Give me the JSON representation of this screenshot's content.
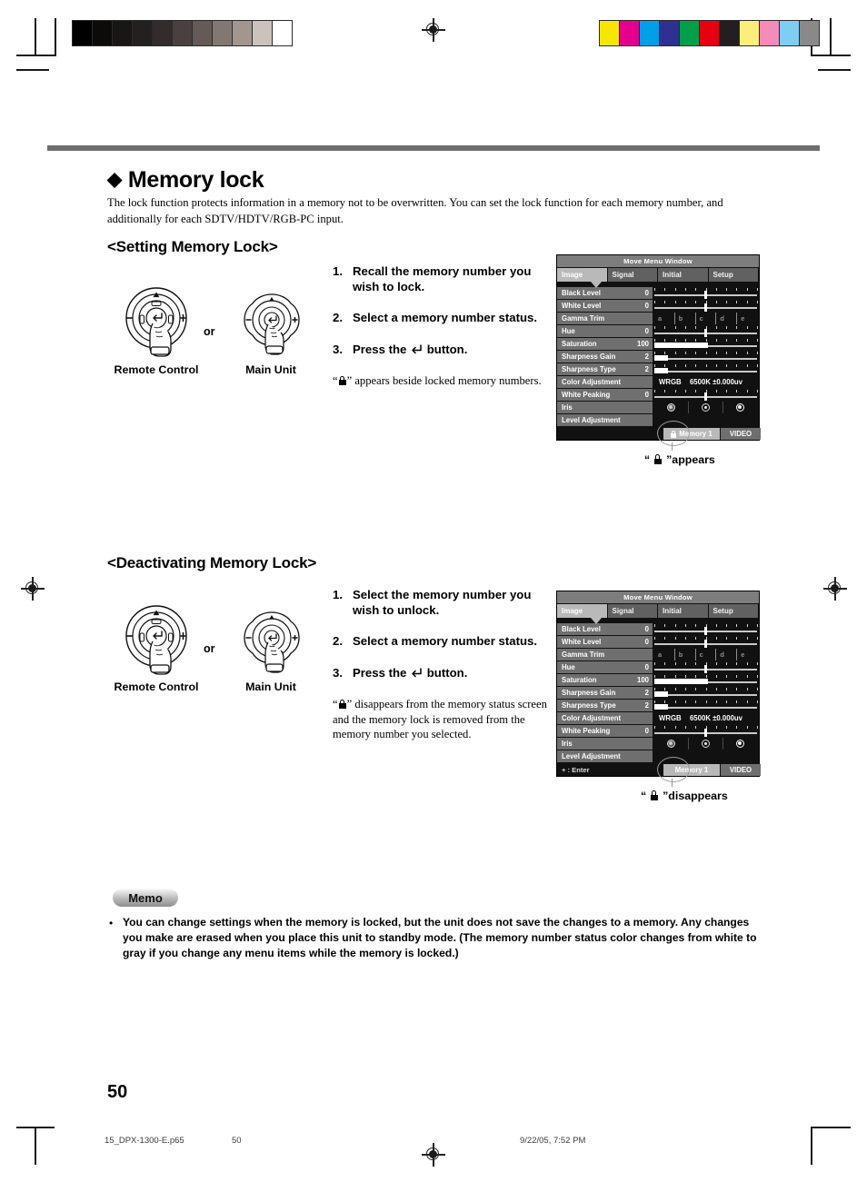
{
  "page": {
    "number": "50",
    "title": "Memory lock",
    "title_bullet": "◆",
    "intro": "The lock function protects information in a memory not to be overwritten. You can set the lock function for each memory number, and additionally for each SDTV/HDTV/RGB-PC input."
  },
  "sections": [
    {
      "heading": "<Setting Memory Lock>",
      "steps": [
        {
          "num": "1.",
          "text": "Recall the memory number you wish to lock."
        },
        {
          "num": "2.",
          "text": "Select a memory number status."
        },
        {
          "num": "3.",
          "text": "Press the  button."
        }
      ],
      "note_prefix": "“",
      "note_suffix": "” appears beside locked memory numbers.",
      "caption_prefix": "“",
      "caption_suffix": "”appears"
    },
    {
      "heading": "<Deactivating Memory Lock>",
      "steps": [
        {
          "num": "1.",
          "text": "Select the memory number you wish to unlock."
        },
        {
          "num": "2.",
          "text": "Select a memory number status."
        },
        {
          "num": "3.",
          "text": "Press the  button."
        }
      ],
      "note_prefix": "“",
      "note_suffix": "” disappears from the memory status screen and the memory lock is removed from the memory number you selected.",
      "caption_prefix": "“",
      "caption_suffix": "”disappears"
    }
  ],
  "controls": {
    "remote_label": "Remote Control",
    "main_label": "Main Unit",
    "or_label": "or",
    "up_glyph": "▲",
    "minus_glyph": "–",
    "plus_glyph": "+"
  },
  "osd": {
    "window_title": "Move Menu Window",
    "tabs": [
      {
        "label": "Image",
        "active": true
      },
      {
        "label": "Signal",
        "active": false
      },
      {
        "label": "Initial",
        "active": false
      },
      {
        "label": "Setup",
        "active": false
      }
    ],
    "rows": [
      {
        "label": "Black Level",
        "value": "0",
        "ctl": "slider",
        "pos": 50
      },
      {
        "label": "White Level",
        "value": "0",
        "ctl": "slider",
        "pos": 50
      },
      {
        "label": "Gamma Trim",
        "value": "",
        "ctl": "segments",
        "segments": [
          "a",
          "b",
          "c",
          "d",
          "e"
        ]
      },
      {
        "label": "Hue",
        "value": "0",
        "ctl": "slider",
        "pos": 50
      },
      {
        "label": "Saturation",
        "value": "100",
        "ctl": "fill",
        "pos": 52
      },
      {
        "label": "Sharpness Gain",
        "value": "2",
        "ctl": "fill",
        "pos": 13
      },
      {
        "label": "Sharpness Type",
        "value": "2",
        "ctl": "fill",
        "pos": 13
      },
      {
        "label": "Color Adjustment",
        "value": "",
        "ctl": "coloradj",
        "a": "WRGB",
        "b": "6500K ±0.000uv"
      },
      {
        "label": "White Peaking",
        "value": "0",
        "ctl": "slider",
        "pos": 50
      },
      {
        "label": "Iris",
        "value": "",
        "ctl": "iris"
      },
      {
        "label": "Level Adjustment",
        "value": "",
        "ctl": "none"
      }
    ],
    "memory_label": "Memory 1",
    "input_label": "VIDEO",
    "enter_hint": "+ : Enter"
  },
  "memo": {
    "title": "Memo",
    "bullet": "•",
    "text": "You can change settings when the memory is locked, but the unit does not save the changes to a memory. Any changes you make are erased when you place this unit to standby mode. (The memory number status color changes from white to gray if you change any menu items while the memory is locked.)"
  },
  "print_footer": {
    "filename": "15_DPX-1300-E.p65",
    "page": "50",
    "timestamp": "9/22/05, 7:52 PM"
  },
  "calibration": {
    "gray_steps": [
      "#000000",
      "#0d0a0a",
      "#1a1615",
      "#252020",
      "#332c2a",
      "#4a413e",
      "#655a55",
      "#837771",
      "#a2968f",
      "#cbc2bc",
      "#ffffff"
    ],
    "color_bars": [
      "#f7e600",
      "#e4008c",
      "#00a0e9",
      "#2e3192",
      "#00a04a",
      "#e60012",
      "#231f20",
      "#fbee7a",
      "#f58bb8",
      "#7ecef4",
      "#898989"
    ]
  }
}
